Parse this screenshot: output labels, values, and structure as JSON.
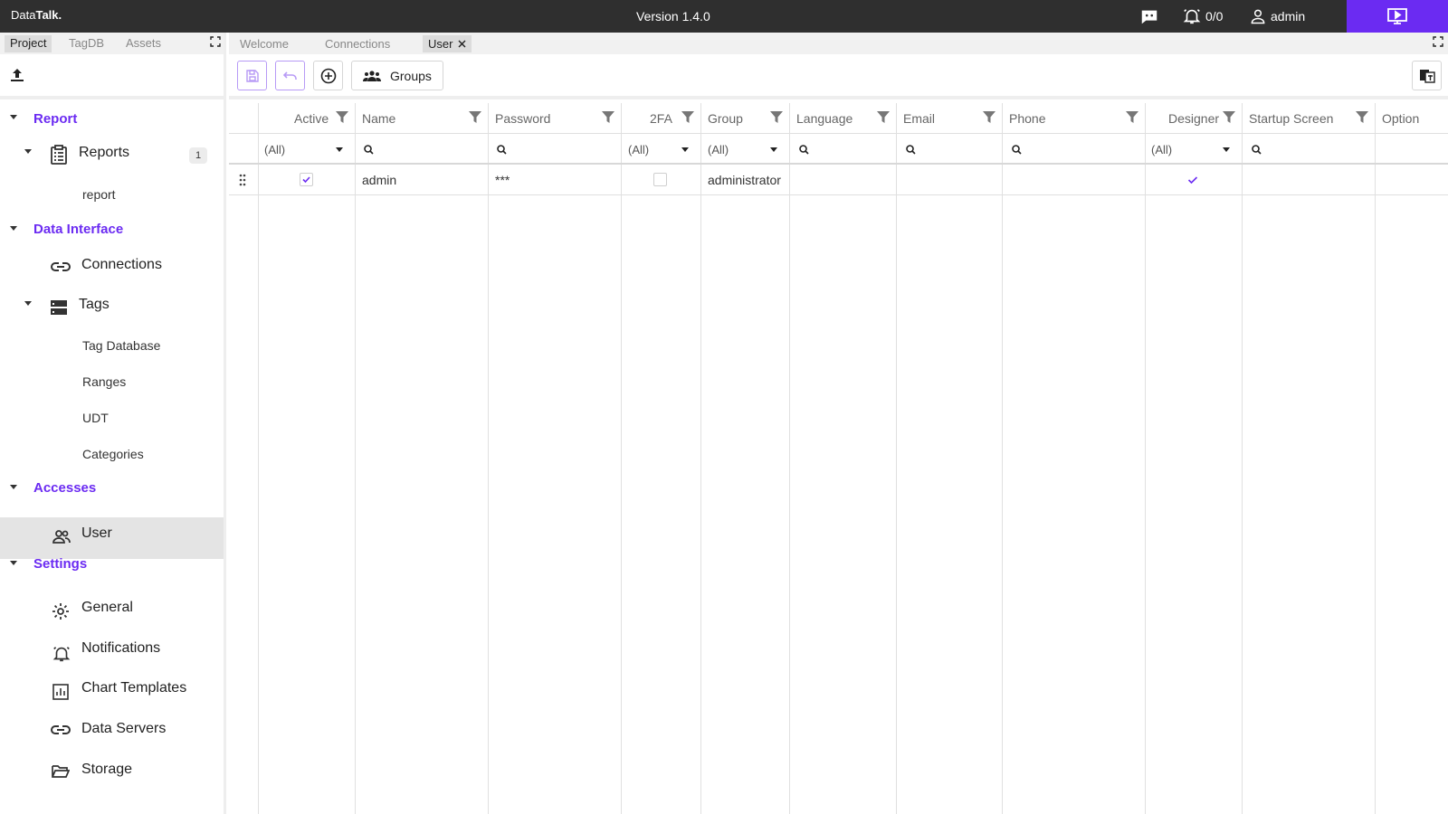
{
  "topbar": {
    "brand_prefix": "Data",
    "brand_bold": "Talk.",
    "version": "Version 1.4.0",
    "alarm_count": "0/0",
    "user": "admin",
    "accent_color": "#6b2bf2"
  },
  "left_panel": {
    "tabs": [
      "Project",
      "TagDB",
      "Assets"
    ],
    "active_tab": "Project",
    "tree": {
      "report_section": "Report",
      "reports_node": "Reports",
      "reports_badge": "1",
      "report_leaf": "report",
      "data_interface_section": "Data Interface",
      "connections_node": "Connections",
      "tags_node": "Tags",
      "tag_database_leaf": "Tag Database",
      "ranges_leaf": "Ranges",
      "udt_leaf": "UDT",
      "categories_leaf": "Categories",
      "accesses_section": "Accesses",
      "user_node": "User",
      "settings_section": "Settings",
      "general_node": "General",
      "notifications_node": "Notifications",
      "chart_templates_node": "Chart Templates",
      "data_servers_node": "Data Servers",
      "storage_node": "Storage"
    }
  },
  "doc_tabs": {
    "welcome": "Welcome",
    "connections": "Connections",
    "user": "User"
  },
  "toolbar": {
    "groups_label": "Groups"
  },
  "grid": {
    "columns": {
      "active": "Active",
      "name": "Name",
      "password": "Password",
      "twofa": "2FA",
      "group": "Group",
      "language": "Language",
      "email": "Email",
      "phone": "Phone",
      "designer": "Designer",
      "startup_screen": "Startup Screen",
      "options": "Option"
    },
    "filters": {
      "active": "(All)",
      "twofa": "(All)",
      "group": "(All)",
      "designer": "(All)"
    },
    "rows": [
      {
        "active": true,
        "name": "admin",
        "password": "***",
        "twofa": false,
        "group": "administrator",
        "language": "",
        "email": "",
        "phone": "",
        "designer": true,
        "startup_screen": ""
      }
    ]
  }
}
